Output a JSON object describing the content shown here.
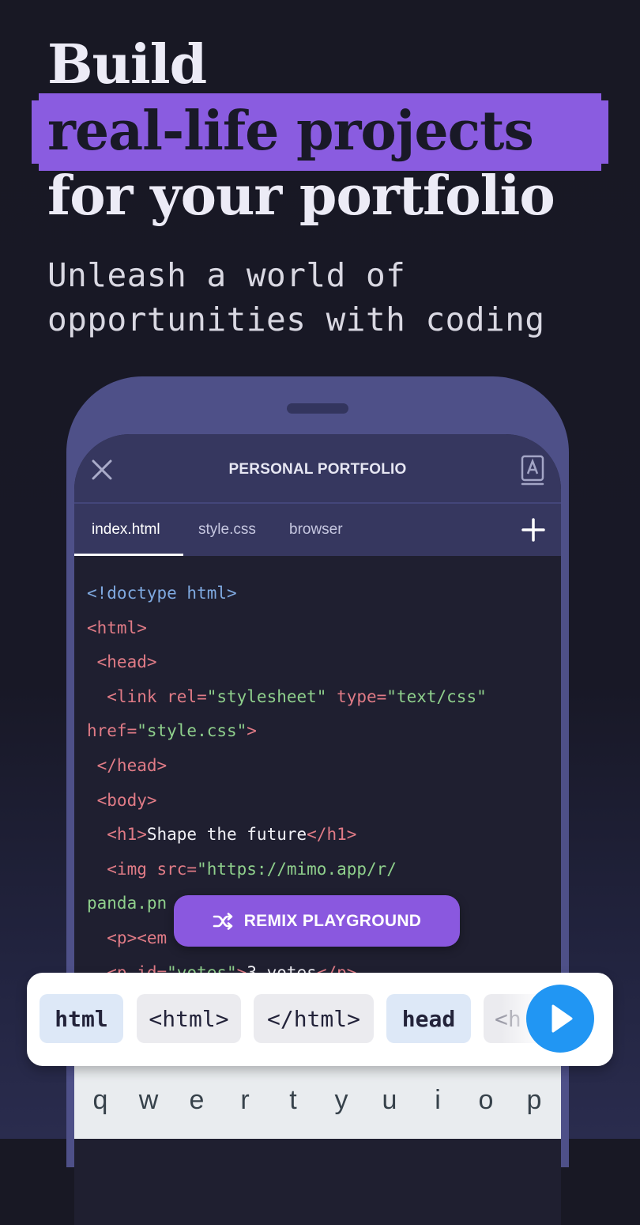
{
  "hero": {
    "line1": "Build",
    "line2_highlight": "real-life projects",
    "line3": "for your portfolio",
    "subtitle_line1": "Unleash a world of",
    "subtitle_line2": "opportunities with coding",
    "highlight_color": "#8a5ce0"
  },
  "app": {
    "title": "PERSONAL PORTFOLIO",
    "close_icon": "close-icon",
    "reference_icon": "book-reference-icon",
    "tabs": [
      {
        "label": "index.html",
        "active": true
      },
      {
        "label": "style.css",
        "active": false
      },
      {
        "label": "browser",
        "active": false
      }
    ],
    "add_icon": "plus-icon"
  },
  "code": {
    "lines": [
      [
        {
          "t": "<!doctype html>",
          "c": "doc"
        }
      ],
      [
        {
          "t": "<html>",
          "c": "tag"
        }
      ],
      [
        {
          "t": " <head>",
          "c": "tag"
        }
      ],
      [
        {
          "t": "  <link rel=",
          "c": "tag"
        },
        {
          "t": "\"stylesheet\"",
          "c": "str"
        },
        {
          "t": " type=",
          "c": "tag"
        },
        {
          "t": "\"text/css\"",
          "c": "str"
        }
      ],
      [
        {
          "t": "href=",
          "c": "tag"
        },
        {
          "t": "\"style.css\"",
          "c": "str"
        },
        {
          "t": ">",
          "c": "tag"
        }
      ],
      [
        {
          "t": " </head>",
          "c": "tag"
        }
      ],
      [
        {
          "t": " <body>",
          "c": "tag"
        }
      ],
      [
        {
          "t": "  <h1>",
          "c": "tag"
        },
        {
          "t": "Shape the future",
          "c": "txt"
        },
        {
          "t": "</h1>",
          "c": "tag"
        }
      ],
      [
        {
          "t": "  <img src=",
          "c": "tag"
        },
        {
          "t": "\"https://mimo.app/r/",
          "c": "str"
        }
      ],
      [
        {
          "t": "panda.pn",
          "c": "str"
        }
      ],
      [
        {
          "t": "  <p><em",
          "c": "tag"
        }
      ],
      [
        {
          "t": "  <p id=",
          "c": "tag"
        },
        {
          "t": "\"votes\"",
          "c": "str"
        },
        {
          "t": ">",
          "c": "tag"
        },
        {
          "t": "3 votes",
          "c": "txt"
        },
        {
          "t": "</p>",
          "c": "tag"
        }
      ]
    ]
  },
  "remix": {
    "label": "REMIX PLAYGROUND",
    "icon": "shuffle-icon",
    "color": "#8a58df"
  },
  "tokens": {
    "chips": [
      {
        "label": "html",
        "kind": "keyword"
      },
      {
        "label": "<html>",
        "kind": "tag"
      },
      {
        "label": "</html>",
        "kind": "tag"
      },
      {
        "label": "head",
        "kind": "keyword"
      },
      {
        "label": "<h",
        "kind": "tag-partial"
      }
    ],
    "run_icon": "play-icon",
    "run_color": "#2196f3"
  },
  "keyboard": {
    "keys": [
      "q",
      "w",
      "e",
      "r",
      "t",
      "y",
      "u",
      "i",
      "o",
      "p"
    ]
  }
}
